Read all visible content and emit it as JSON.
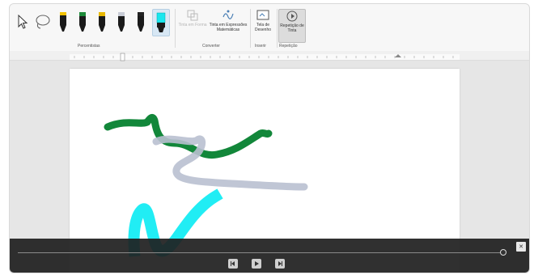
{
  "ribbon": {
    "groups": {
      "pens": "Percentistas",
      "convert": "Converter",
      "insert": "Inserir",
      "replay": "Repetição"
    },
    "buttons": {
      "ink_to_shape": "Tinta em Forma",
      "ink_to_math": "Tinta em Expressões Matemáticas",
      "drawing_canvas": "Tela de Desenho",
      "ink_replay": "Repetição de Tinta"
    }
  },
  "pens": [
    {
      "name": "pen-black",
      "color": "#1a1a1a",
      "tip": "#f2c200"
    },
    {
      "name": "pen-green",
      "color": "#1a1a1a",
      "tip": "#1e8a3a"
    },
    {
      "name": "pen-yellow-pen",
      "color": "#1a1a1a",
      "tip": "#e8b800"
    },
    {
      "name": "pen-gray",
      "color": "#1a1a1a",
      "tip": "#c8ccd6"
    },
    {
      "name": "pen-black-2",
      "color": "#1a1a1a",
      "tip": "#222222"
    },
    {
      "name": "highlighter-cyan",
      "color": "#1a1a1a",
      "tip": "#19e6ee"
    }
  ],
  "ink": {
    "green": "#12873a",
    "gray": "#b9c0d0",
    "cyan": "#15ecf3"
  },
  "player": {
    "progress": 1.0
  }
}
